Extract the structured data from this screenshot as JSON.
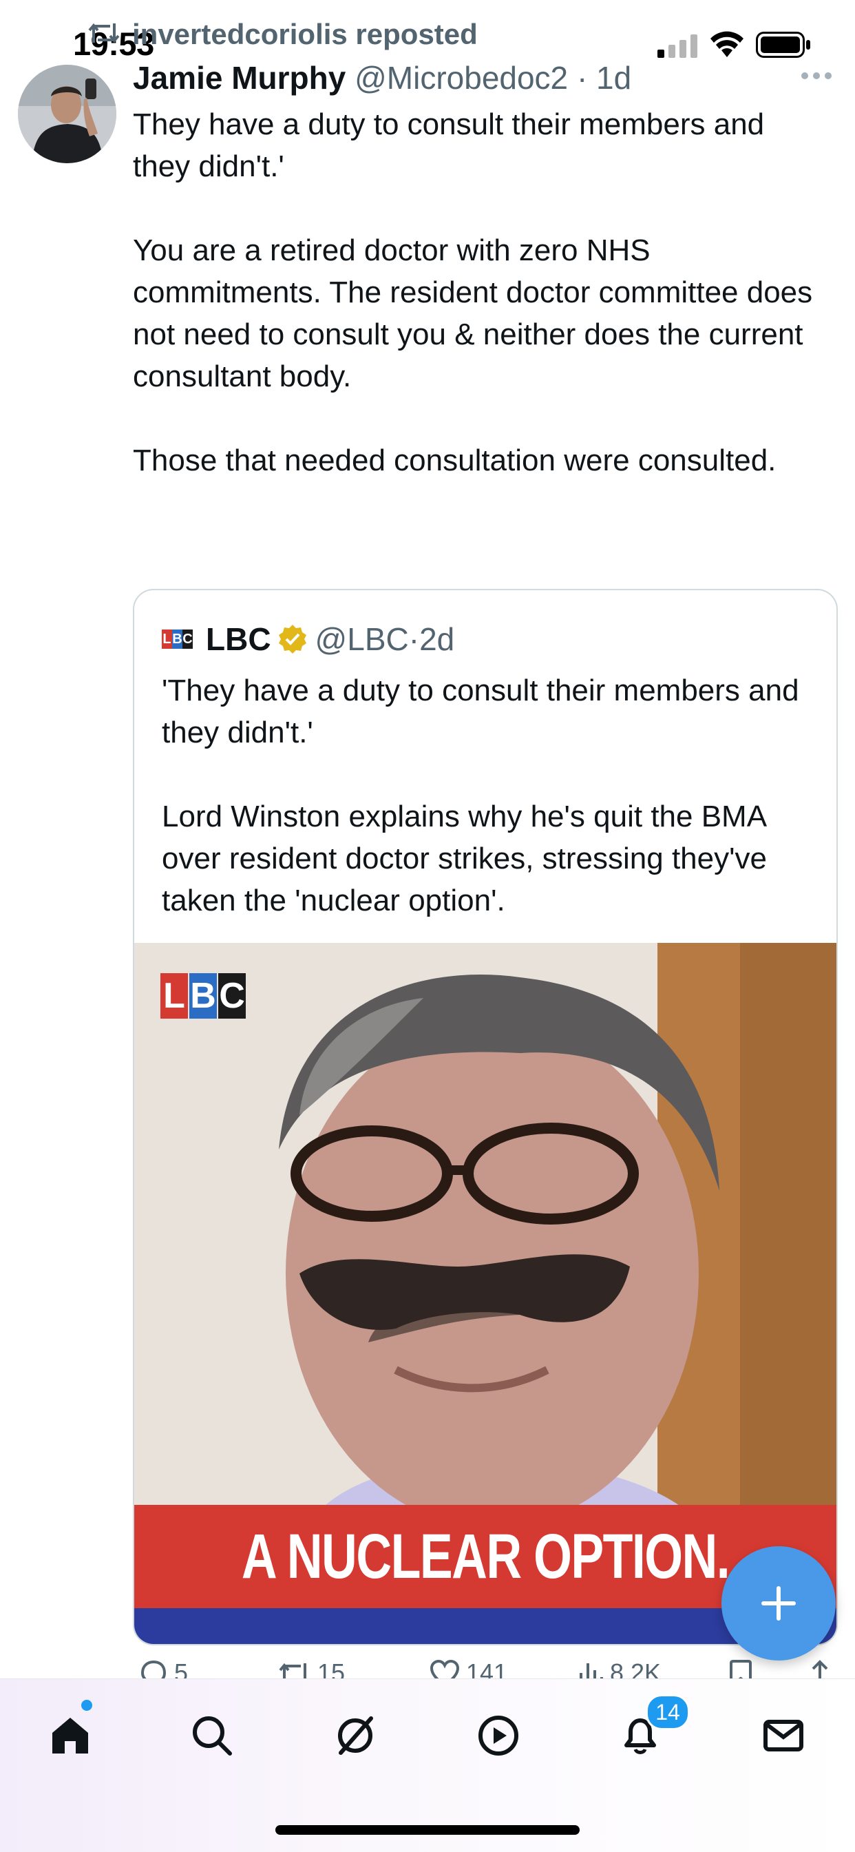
{
  "status_bar": {
    "time": "19:53"
  },
  "repost": {
    "text": "invertedcoriolis reposted"
  },
  "tweet": {
    "author_name": "Jamie Murphy",
    "author_handle": "@Microbedoc2",
    "separator": "·",
    "time": "1d",
    "paragraphs": [
      "They have a duty to consult their members and they didn't.'",
      "You are a retired doctor with zero NHS commitments. The resident doctor committee does not need to consult you & neither does the current consultant body.",
      "Those that needed consultation were consulted."
    ]
  },
  "quote": {
    "name": "LBC",
    "handle": "@LBC",
    "separator": "·",
    "time": "2d",
    "logo_letters": [
      "L",
      "B",
      "C"
    ],
    "paragraphs": [
      "'They have a duty to consult their members and they didn't.'",
      "Lord Winston explains why he's quit the BMA over resident doctor strikes, stressing they've taken the 'nuclear option'."
    ],
    "media_banner": "A NUCLEAR OPTION."
  },
  "actions": {
    "replies": "5",
    "reposts": "15",
    "likes": "141",
    "views": "8.2K"
  },
  "tab_bar": {
    "items": [
      "home",
      "search",
      "grok",
      "video",
      "notifications",
      "messages"
    ],
    "notifications_badge": "14"
  },
  "colors": {
    "accent": "#1d9bf0",
    "fab": "#4a99e9",
    "banner_red": "#d53a32",
    "banner_blue": "#2c3c9e",
    "secondary_text": "#536471"
  }
}
